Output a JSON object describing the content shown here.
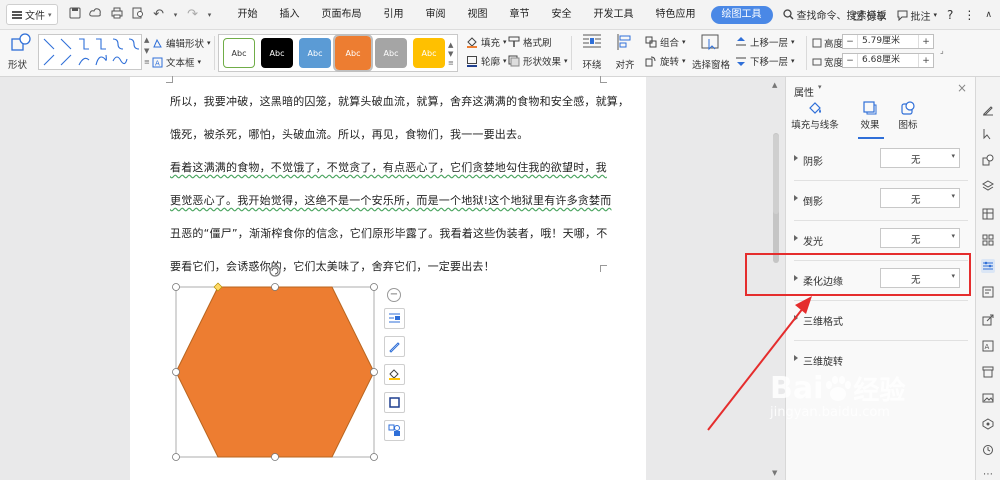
{
  "menubar": {
    "file_label": "文件",
    "tabs": [
      "开始",
      "插入",
      "页面布局",
      "引用",
      "审阅",
      "视图",
      "章节",
      "安全",
      "开发工具",
      "特色应用",
      "绘图工具"
    ],
    "active_tab": "绘图工具",
    "search_label": "查找命令、搜索模板",
    "share_label": "分享",
    "annotate_label": "批注",
    "help_icon": "?"
  },
  "ribbon": {
    "shape_label": "形状",
    "edit_shape_label": "编辑形状",
    "textbox_label": "文本框",
    "style_boxes": [
      {
        "label": "Abc",
        "fill": "#ffffff",
        "border": "#70ad47",
        "color": "#333333"
      },
      {
        "label": "Abc",
        "fill": "#000000",
        "border": "#000000",
        "color": "#ffffff"
      },
      {
        "label": "Abc",
        "fill": "#5b9bd5",
        "border": "#5b9bd5",
        "color": "#ffffff"
      },
      {
        "label": "Abc",
        "fill": "#ed7d31",
        "border": "#ed7d31",
        "color": "#ffffff"
      },
      {
        "label": "Abc",
        "fill": "#a5a5a5",
        "border": "#a5a5a5",
        "color": "#ffffff"
      },
      {
        "label": "Abc",
        "fill": "#ffc000",
        "border": "#ffc000",
        "color": "#ffffff"
      }
    ],
    "fill_label": "填充",
    "format_brush_label": "格式刷",
    "outline_label": "轮廓",
    "shape_effect_label": "形状效果",
    "wrap_label": "环绕",
    "align_label": "对齐",
    "group_label": "组合",
    "rotate_label": "旋转",
    "selection_pane_label": "选择窗格",
    "bring_forward_label": "上移一层",
    "send_backward_label": "下移一层",
    "height_label": "高度:",
    "height_value": "5.79厘米",
    "width_label": "宽度:",
    "width_value": "6.68厘米"
  },
  "document": {
    "lines": [
      {
        "text": "所以，我要冲破，这黑暗的囚笼，就算头破血流，就算，舍弃这满满的食物和安全感，就算，",
        "wavy": false
      },
      {
        "text": "饿死，被杀死，哪怕，头破血流。所以，再见，食物们，我一一要出去。",
        "wavy": false
      },
      {
        "text": "  看着这满满的食物，不觉饿了，不觉贪了，有点恶心了，它们贪婪地勾住我的欲望时，我",
        "wavy": true
      },
      {
        "text": "更觉恶心了。我开始觉得，这绝不是一个安乐所，而是一个地狱!这个地狱里有许多贪婪而",
        "wavy": true
      },
      {
        "text": "丑恶的“僵尸”，渐渐榨食你的信念，它们原形毕露了。我看着这些伪装者，哦！天哪，不",
        "wavy": false
      },
      {
        "text": "要看它们，会诱惑你的，它们太美味了，舍弃它们，一定要出去！",
        "wavy": false
      }
    ],
    "shape_fill": "#ed7d31",
    "shape_stroke": "#b8651f"
  },
  "panel": {
    "title": "属性",
    "tabs": [
      "填充与线条",
      "效果",
      "图标"
    ],
    "active_tab": "效果",
    "rows": [
      {
        "label": "阴影",
        "value": "无"
      },
      {
        "label": "倒影",
        "value": "无"
      },
      {
        "label": "发光",
        "value": "无"
      },
      {
        "label": "柔化边缘",
        "value": "无"
      },
      {
        "label": "三维格式",
        "value": ""
      },
      {
        "label": "三维旋转",
        "value": ""
      }
    ],
    "highlight_color": "#e52d2d"
  },
  "watermark": {
    "brand": "Bai",
    "brand_suffix": "经验",
    "url": "jingyan.baidu.com"
  }
}
